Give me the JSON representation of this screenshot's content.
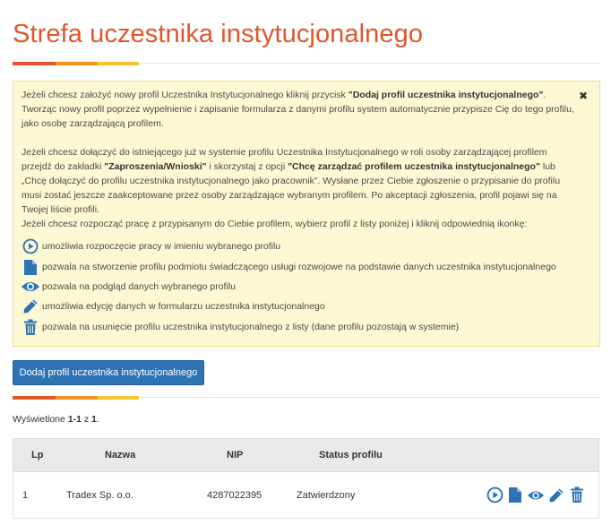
{
  "page_title": "Strefa uczestnika instytucjonalnego",
  "info": {
    "close_symbol": "✖",
    "p1_a": "Jeżeli chcesz założyć nowy profil Uczestnika Instytucjonalnego kliknij przycisk ",
    "p1_b": "\"Dodaj profil uczestnika instytucjonalnego\"",
    "p1_c": ". Tworząc nowy profil poprzez wypełnienie i zapisanie formularza z danymi profilu system automatycznie przypisze Cię do tego profilu, jako osobę zarządzającą profilem.",
    "p2_a": "Jeżeli chcesz dołączyć do istniejącego już w systemie profilu Uczestnika Instytucjonalnego w roli osoby zarządzającej profilem przejdź do zakładki ",
    "p2_b": "\"Zaproszenia/Wnioski\"",
    "p2_c": " i skorzystaj z opcji ",
    "p2_d": "\"Chcę zarządzać profilem uczestnika instytucjonalnego\"",
    "p2_e": " lub „Chcę dołączyć do profilu uczestnika instytucjonalnego jako pracownik”. Wysłane przez Ciebie zgłoszenie o przypisanie do profilu musi zostać jeszcze zaakceptowane przez osoby zarządzające wybranym profilem. Po akceptacji zgłoszenia, profil pojawi się na Twojej liście profili.",
    "p3": "Jeżeli chcesz rozpocząć pracę z przypisanym do Ciebie profilem, wybierz profil z listy poniżej i kliknij odpowiednią ikonkę:",
    "legend": [
      {
        "icon": "play-circle-icon",
        "text": "umożliwia rozpoczęcie pracy w imieniu wybranego profilu"
      },
      {
        "icon": "document-icon",
        "text": "pozwala na stworzenie profilu podmiotu świadczącego usługi rozwojowe na podstawie danych uczestnika instytucjonalnego"
      },
      {
        "icon": "eye-icon",
        "text": "pozwala na podgląd danych wybranego profilu"
      },
      {
        "icon": "pencil-icon",
        "text": "umożliwia edycję danych w formularzu uczestnika instytucjonalnego"
      },
      {
        "icon": "trash-icon",
        "text": "pozwala na usunięcie profilu uczestnika instytucjonalnego z listy (dane profilu pozostają w systemie)"
      }
    ]
  },
  "add_button_label": "Dodaj profil uczestnika instytucjonalnego",
  "shown": {
    "prefix": "Wyświetlone ",
    "range": "1-1",
    "mid": " z ",
    "total": "1",
    "suffix": "."
  },
  "table": {
    "headers": {
      "lp": "Lp",
      "name": "Nazwa",
      "nip": "NIP",
      "status": "Status profilu"
    },
    "rows": [
      {
        "lp": "1",
        "name": "Tradex Sp. o.o.",
        "nip": "4287022395",
        "status": "Zatwierdzony"
      }
    ]
  },
  "colors": {
    "title": "#e0562a",
    "icon_blue": "#2e74b5",
    "button_bg": "#2e74b5",
    "info_bg": "#fcf8d4"
  }
}
